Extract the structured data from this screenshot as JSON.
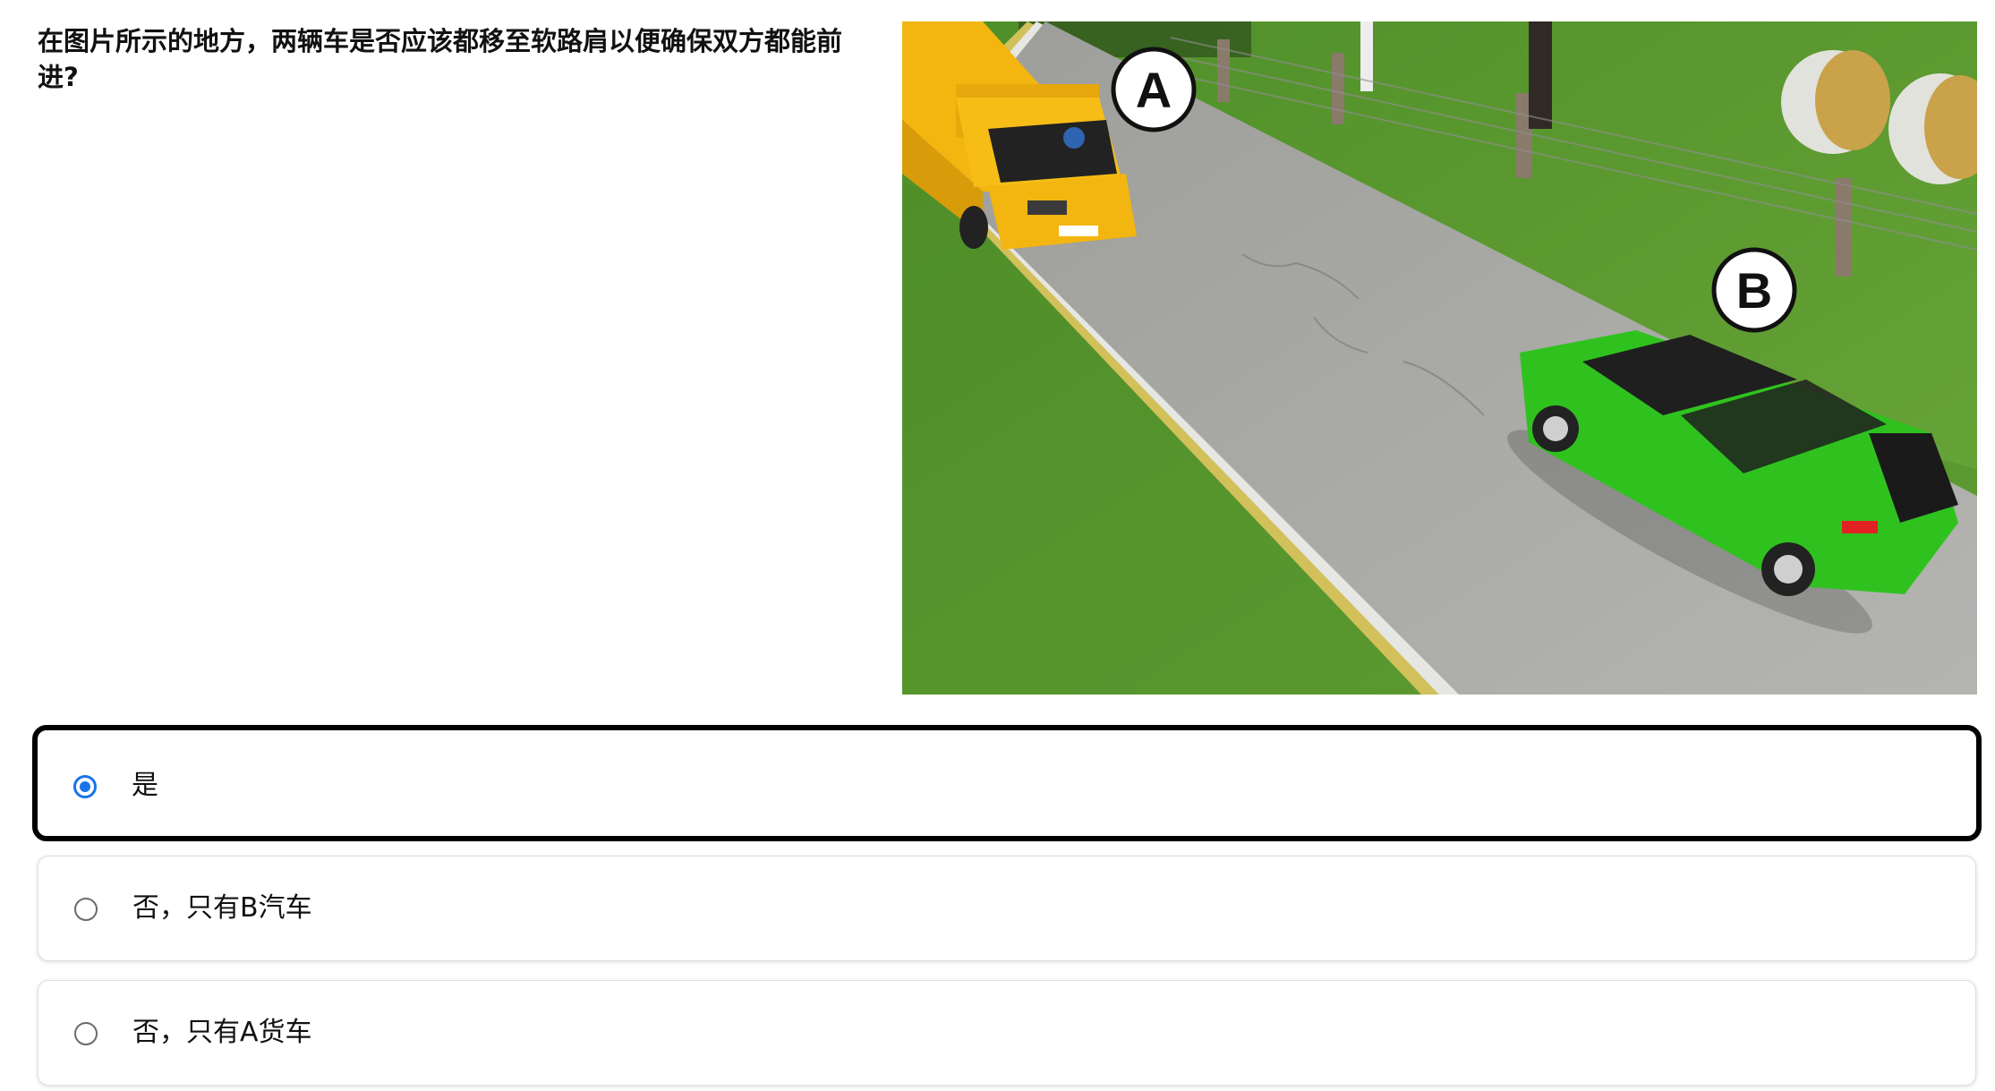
{
  "question": {
    "text": "在图片所示的地方，两辆车是否应该都移至软路肩以便确保双方都能前进?"
  },
  "illustration": {
    "marker_a": "A",
    "marker_b": "B",
    "colors": {
      "grass": "#5f9a2f",
      "road": "#a9a9a6",
      "truck": "#f3b510",
      "car": "#2fc21f"
    }
  },
  "answers": {
    "selected_index": 0,
    "options": [
      {
        "label": "是",
        "selected": true
      },
      {
        "label": "否，只有B汽车",
        "selected": false
      },
      {
        "label": "否，只有A货车",
        "selected": false
      }
    ],
    "radio_color": "#1a73e8"
  }
}
